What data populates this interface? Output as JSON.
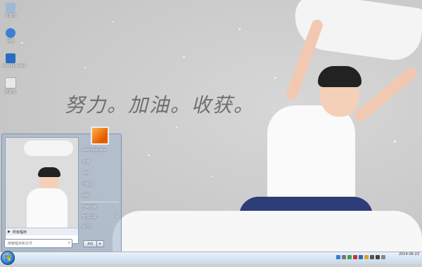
{
  "desktop": {
    "icons": [
      {
        "name": "computer-icon",
        "label": "计算机",
        "color": "#9fb8d6"
      },
      {
        "name": "network-icon",
        "label": "网络",
        "color": "#3f7fd0"
      },
      {
        "name": "admin-folder-icon",
        "label": "Administrator",
        "color": "#2c6cc0"
      },
      {
        "name": "recycle-bin-icon",
        "label": "回收站",
        "color": "#e8e8e8"
      }
    ],
    "slogan": "努力。加油。收获。"
  },
  "start_menu": {
    "right_items": [
      {
        "label": "Administrator"
      },
      {
        "label": "文档"
      },
      {
        "label": "游戏"
      },
      {
        "label": "计算机"
      },
      {
        "label": "网络"
      },
      {
        "label": "控制面板"
      },
      {
        "label": "管理工具",
        "has_submenu": true
      },
      {
        "label": "运行..."
      }
    ],
    "all_programs": "所有程序",
    "search_placeholder": "搜索程序和文件",
    "shutdown_label": "关机"
  },
  "taskbar": {
    "clock_time": "",
    "clock_date": "2014-06-23"
  },
  "colors": {
    "taskbar": "#dbe6f2",
    "start_orb": "#1f6fc4"
  }
}
